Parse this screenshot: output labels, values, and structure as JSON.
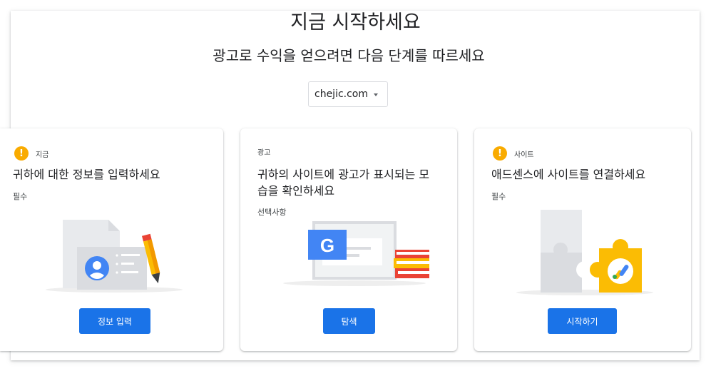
{
  "header": {
    "title": "지금 시작하세요",
    "subtitle": "광고로 수익을 얻으려면 다음 단계를 따르세요"
  },
  "site_selector": {
    "value": "chejic.com"
  },
  "cards": [
    {
      "status_label": "지금",
      "status_icon": "warning-icon",
      "title": "귀하에 대한 정보를 입력하세요",
      "subtitle": "필수",
      "button": "정보 입력",
      "illustration": "profile-card-illustration"
    },
    {
      "status_label": "광고",
      "title_line1": "귀하의 사이트에 광고가 표시되는 모",
      "title_line2": "습을 확인하세요",
      "subtitle": "선택사항",
      "button": "탐색",
      "illustration": "google-ads-illustration"
    },
    {
      "status_label": "사이트",
      "status_icon": "warning-icon",
      "title": "애드센스에 사이트를 연결하세요",
      "subtitle": "필수",
      "button": "시작하기",
      "illustration": "puzzle-illustration"
    }
  ],
  "colors": {
    "primary_button": "#1a73e8",
    "warning": "#f9ab00",
    "text": "#202124"
  }
}
